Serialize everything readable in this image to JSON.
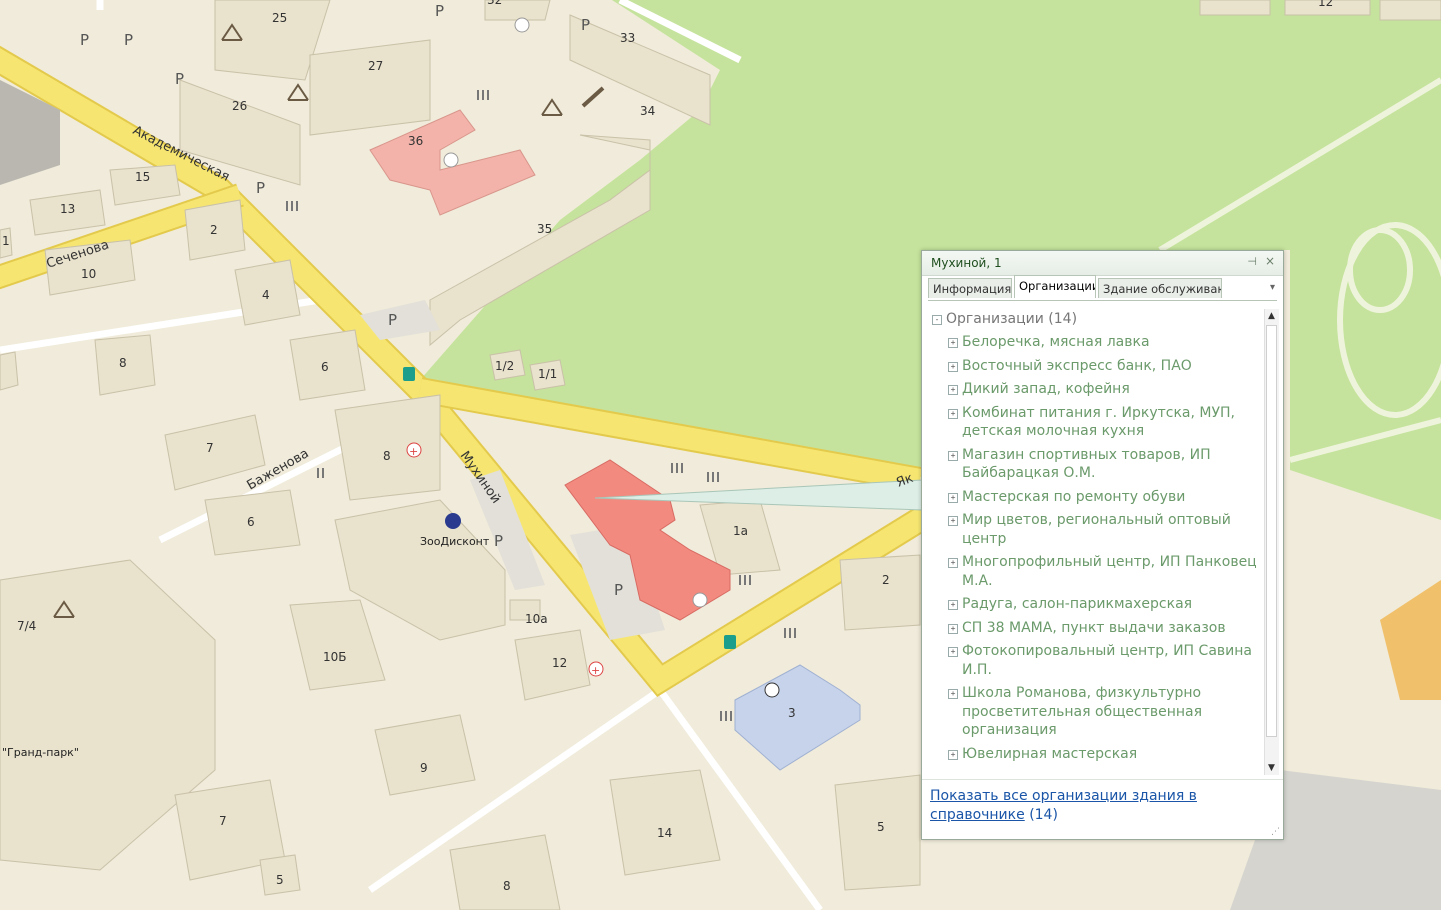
{
  "map": {
    "streets": [
      {
        "id": "akademicheskaya",
        "label": "Академическая"
      },
      {
        "id": "sechenova",
        "label": "Сеченова"
      },
      {
        "id": "bazhenova",
        "label": "Баженова"
      },
      {
        "id": "mukhinoy",
        "label": "Мухиной"
      },
      {
        "id": "yak",
        "label": "Як"
      }
    ],
    "buildings": [
      "25",
      "27",
      "26",
      "33",
      "34",
      "36",
      "35",
      "15",
      "13",
      "10",
      "2",
      "4",
      "6",
      "8",
      "7",
      "6",
      "8",
      "1/2",
      "1/1",
      "1а",
      "2",
      "10а",
      "12",
      "10Б",
      "3",
      "9",
      "7",
      "14",
      "5",
      "8",
      "7/4",
      "1",
      "12",
      "32"
    ],
    "poi": {
      "zoo": "ЗооДисконт",
      "grand_park": "\"Гранд-парк\""
    },
    "parking_symbol": "P",
    "colors": {
      "road": "#f6e671",
      "road_edge": "#e3ca4c",
      "park": "#c5e39c",
      "ground": "#f0ebda",
      "building": "#e9e2cc",
      "selected": "#f28a80",
      "school": "#c7d3ea",
      "pink": "#f3b3aa"
    }
  },
  "card": {
    "title": "Мухиной, 1",
    "tabs": [
      {
        "label": "Информация",
        "active": false
      },
      {
        "label": "Организации",
        "active": true
      },
      {
        "label": "Здание обслуживают",
        "active": false
      }
    ],
    "group": "Организации (14)",
    "orgs": [
      "Белоречка, мясная лавка",
      "Восточный экспресс банк, ПАО",
      "Дикий запад, кофейня",
      "Комбинат питания г. Иркутска, МУП, детская молочная кухня",
      "Магазин спортивных товаров, ИП Байбарацкая О.М.",
      "Мастерская по ремонту обуви",
      "Мир цветов, региональный оптовый центр",
      "Многопрофильный центр, ИП Панковец М.А.",
      "Радуга, салон-парикмахерская",
      "СП 38 МАМА, пункт выдачи заказов",
      "Фотокопировальный центр, ИП Савина И.П.",
      "Школа Романова, физкультурно просветительная общественная организация",
      "Ювелирная мастерская"
    ],
    "footer_link": "Показать все организации здания в справочнике",
    "footer_count": "(14)"
  }
}
